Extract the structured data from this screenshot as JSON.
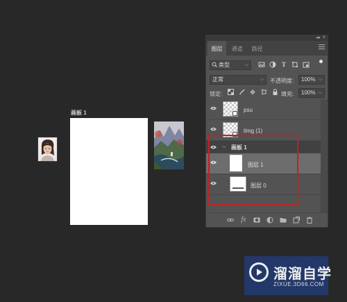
{
  "canvas": {
    "artboard_label": "画板 1"
  },
  "panel": {
    "tabs": [
      {
        "label": "图层",
        "active": true
      },
      {
        "label": "通道",
        "active": false
      },
      {
        "label": "路径",
        "active": false
      }
    ],
    "filter": {
      "kind_label": "类型"
    },
    "blend_mode": "正常",
    "opacity_label": "不透明度:",
    "opacity_value": "100%",
    "lock_label": "锁定:",
    "fill_label": "填充:",
    "fill_value": "100%",
    "layers": [
      {
        "name": "psu",
        "kind": "smart-object",
        "visible": true
      },
      {
        "name": "timg (1)",
        "kind": "smart-object",
        "visible": true
      },
      {
        "name": "画板 1",
        "kind": "artboard",
        "visible": true,
        "expanded": true
      },
      {
        "name": "图层 1",
        "kind": "layer",
        "visible": true,
        "selected": true
      },
      {
        "name": "图层 0",
        "kind": "layer",
        "visible": true
      }
    ],
    "bottom_icons": [
      "link-icon",
      "fx-icon",
      "mask-icon",
      "adjustment-icon",
      "folder-icon",
      "new-layer-icon",
      "trash-icon"
    ],
    "fx_label": "fx"
  },
  "watermark": {
    "title": "溜溜自学",
    "url": "ZIXUE.3D66.COM"
  },
  "colors": {
    "background": "#282828",
    "panel": "#535353",
    "highlight": "#c81e1e",
    "watermark": "#223a6e"
  }
}
